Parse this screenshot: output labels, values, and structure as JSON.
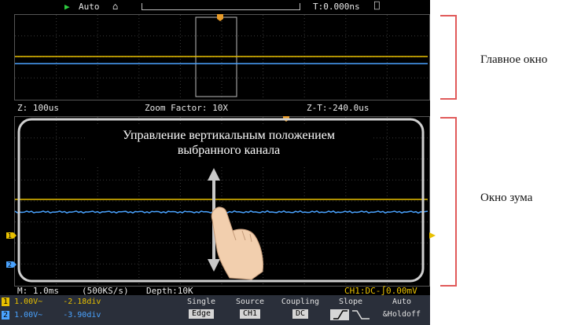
{
  "status_bar": {
    "run_state": "Auto",
    "trigger_time": "T:0.000ns"
  },
  "main_window": {
    "zoom": "Z: 100us",
    "zoom_factor": "Zoom Factor: 10X",
    "zoom_time": "Z-T:-240.0us"
  },
  "zoom_window": {
    "timebase": "M: 1.0ms",
    "sample_rate": "(500KS/s)",
    "depth": "Depth:10K",
    "trigger_info": "CH1:DC-∫0.00mV"
  },
  "callout": {
    "line1": "Управление вертикальным положением",
    "line2": "выбранного канала"
  },
  "channels": [
    {
      "num": "1",
      "volts": "1.00V~",
      "offset": "-2.18div",
      "color": "#e8c000"
    },
    {
      "num": "2",
      "volts": "1.00V~",
      "offset": "-3.90div",
      "color": "#4aa3ff"
    }
  ],
  "menu": {
    "single_label": "Single",
    "single_value": "Edge",
    "source_label": "Source",
    "source_value": "CH1",
    "coupling_label": "Coupling",
    "coupling_value": "DC",
    "slope_label": "Slope",
    "auto_label": "Auto",
    "auto_value": "&Holdoff"
  },
  "annotations": {
    "main_label": "Главное окно",
    "zoom_label": "Окно зума"
  },
  "colors": {
    "ch1": "#e8c000",
    "ch2": "#4aa3ff",
    "bracket": "#e05a5a",
    "trigger_marker": "#e89c2a"
  }
}
